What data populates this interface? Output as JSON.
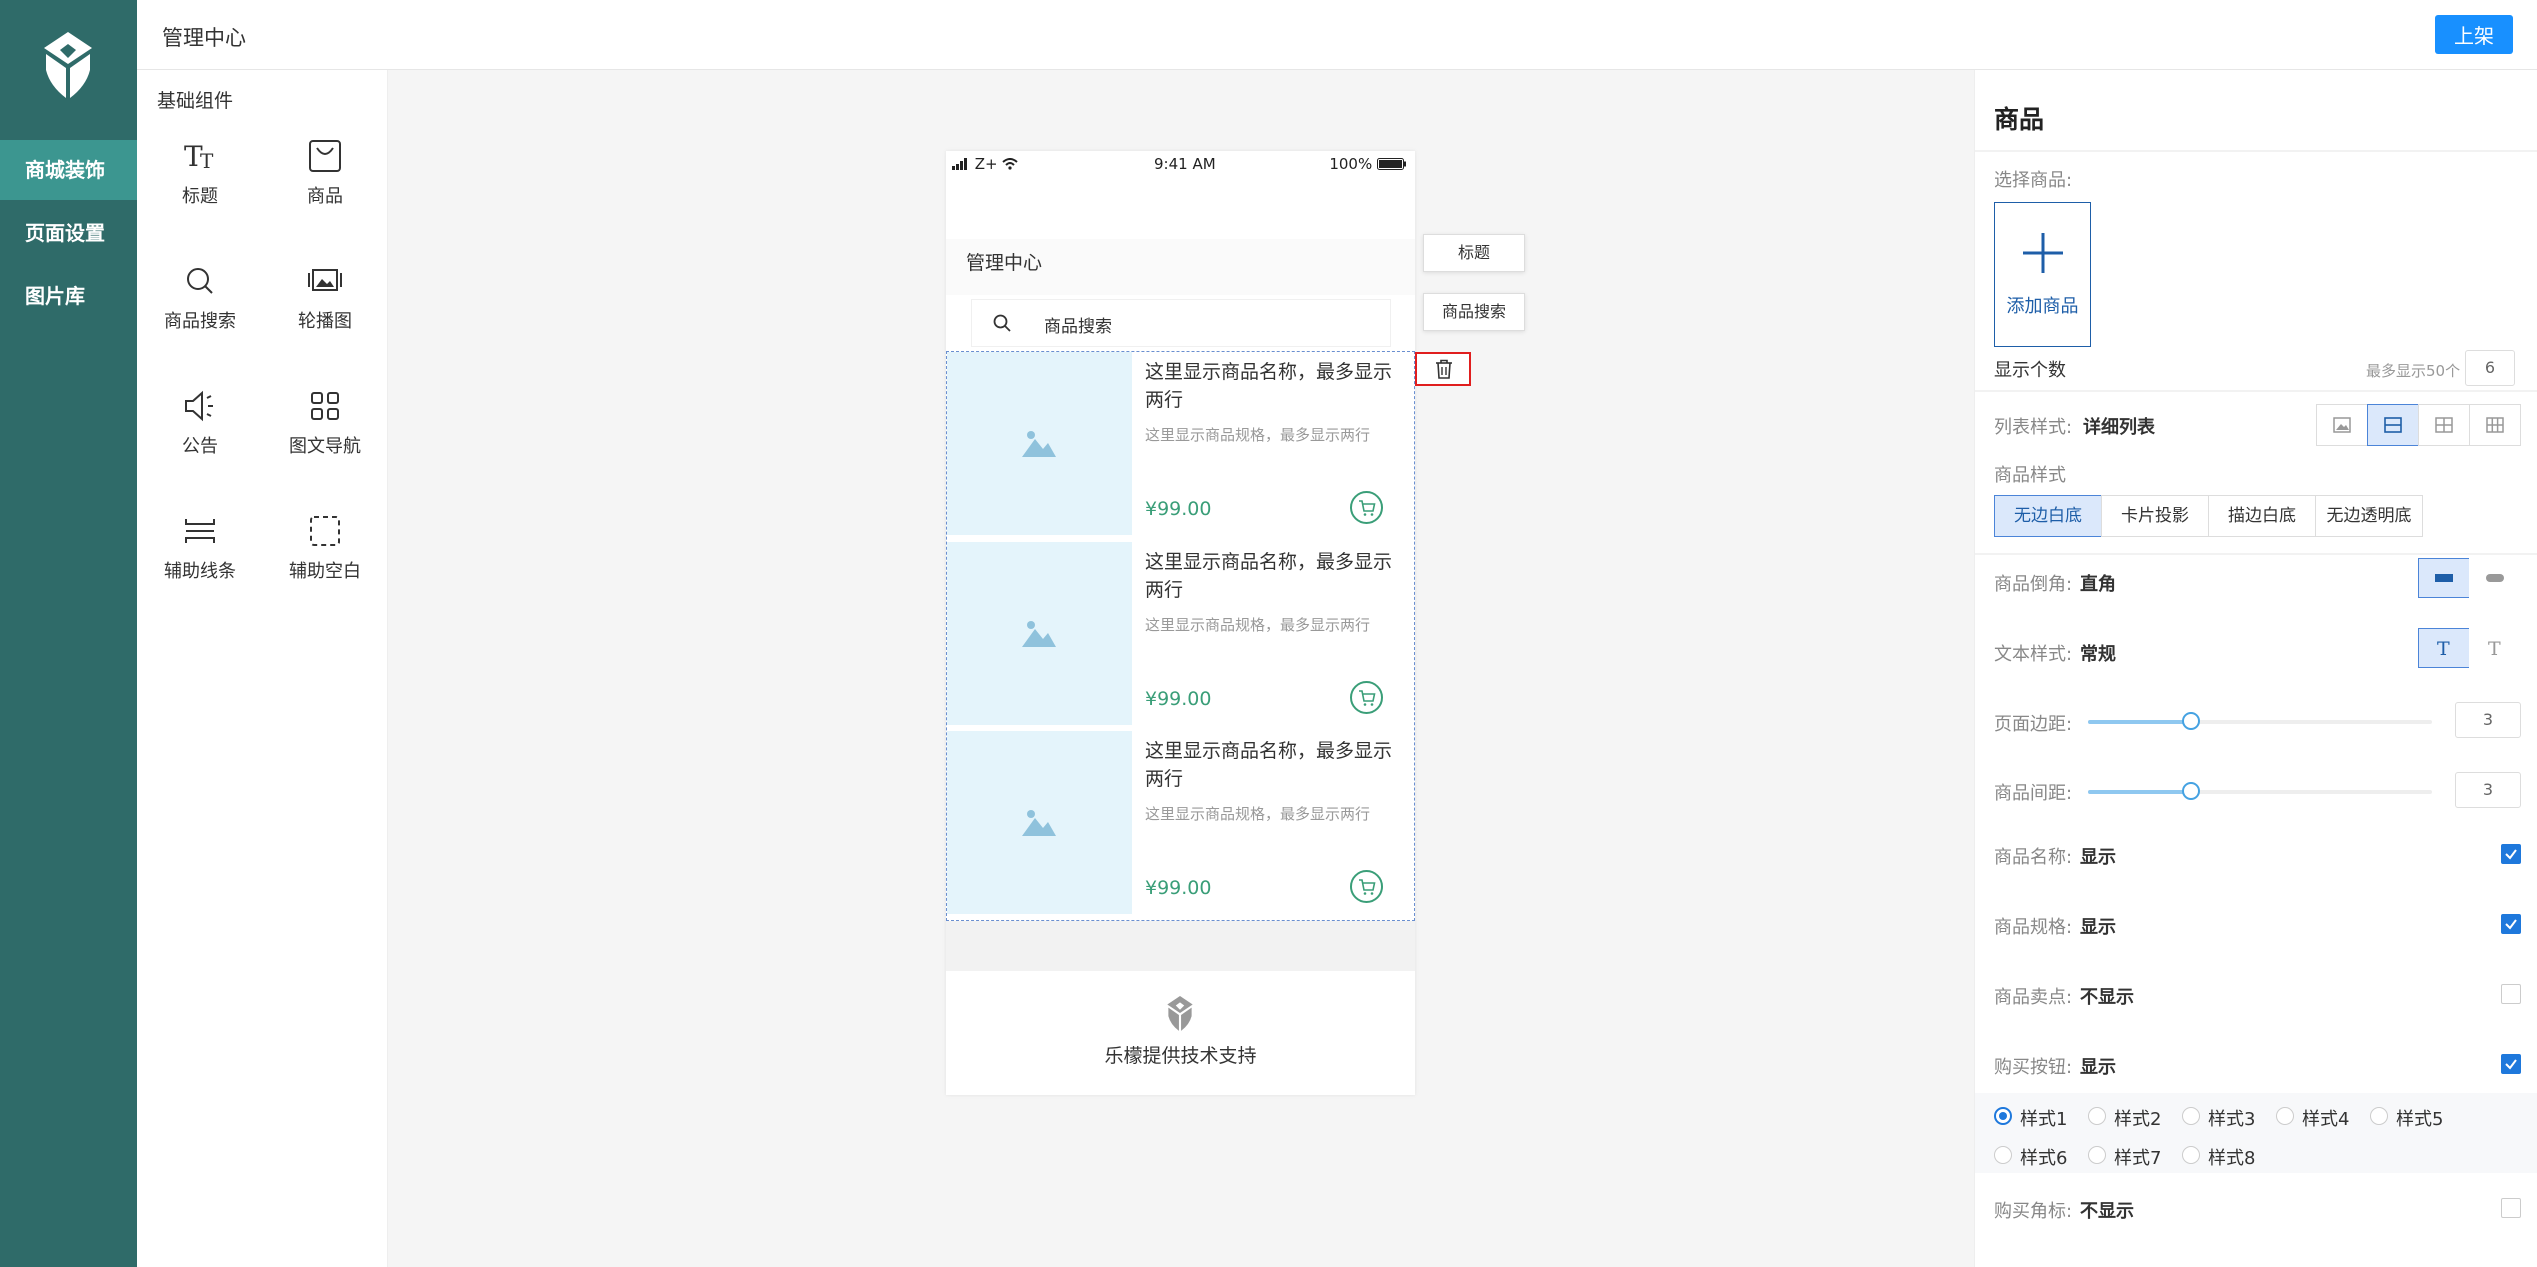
{
  "header": {
    "title": "管理中心",
    "publish_label": "上架"
  },
  "nav": {
    "items": [
      {
        "label": "商城装饰"
      },
      {
        "label": "页面设置"
      },
      {
        "label": "图片库"
      }
    ]
  },
  "components": {
    "title": "基础组件",
    "items": [
      {
        "label": "标题",
        "icon": "title-icon"
      },
      {
        "label": "商品",
        "icon": "bag-icon"
      },
      {
        "label": "商品搜索",
        "icon": "search-icon"
      },
      {
        "label": "轮播图",
        "icon": "carousel-icon"
      },
      {
        "label": "公告",
        "icon": "speaker-icon"
      },
      {
        "label": "图文导航",
        "icon": "grid-icon"
      },
      {
        "label": "辅助线条",
        "icon": "divider-icon"
      },
      {
        "label": "辅助空白",
        "icon": "blank-icon"
      }
    ]
  },
  "phone": {
    "status": {
      "carrier": "Z+",
      "time": "9:41 AM",
      "battery": "100%"
    },
    "title": "管理中心",
    "search_placeholder": "商品搜索",
    "goods": [
      {
        "name": "这里显示商品名称，最多显示两行",
        "spec": "这里显示商品规格，最多显示两行",
        "price": "¥99.00"
      },
      {
        "name": "这里显示商品名称，最多显示两行",
        "spec": "这里显示商品规格，最多显示两行",
        "price": "¥99.00"
      },
      {
        "name": "这里显示商品名称，最多显示两行",
        "spec": "这里显示商品规格，最多显示两行",
        "price": "¥99.00"
      }
    ],
    "footer_text": "乐檬提供技术支持",
    "tags": {
      "title": "标题",
      "search": "商品搜索"
    }
  },
  "props": {
    "title": "商品",
    "select_label": "选择商品:",
    "add_label": "添加商品",
    "count_label": "显示个数",
    "count_hint": "最多显示50个",
    "count_value": "6",
    "list_style_label": "列表样式:",
    "list_style_value": "详细列表",
    "goods_style_label": "商品样式",
    "goods_styles": [
      "无边白底",
      "卡片投影",
      "描边白底",
      "无边透明底"
    ],
    "corner_label": "商品倒角:",
    "corner_value": "直角",
    "text_style_label": "文本样式:",
    "text_style_value": "常规",
    "page_margin_label": "页面边距:",
    "page_margin_value": "3",
    "page_margin_level": 0.3,
    "goods_gap_label": "商品间距:",
    "goods_gap_value": "3",
    "goods_gap_level": 0.3,
    "name_label": "商品名称:",
    "name_value": "显示",
    "spec_label": "商品规格:",
    "spec_value": "显示",
    "selling_label": "商品卖点:",
    "selling_value": "不显示",
    "buy_label": "购买按钮:",
    "buy_value": "显示",
    "buy_styles": [
      "样式1",
      "样式2",
      "样式3",
      "样式4",
      "样式5",
      "样式6",
      "样式7",
      "样式8"
    ],
    "badge_label": "购买角标:",
    "badge_value": "不显示"
  }
}
